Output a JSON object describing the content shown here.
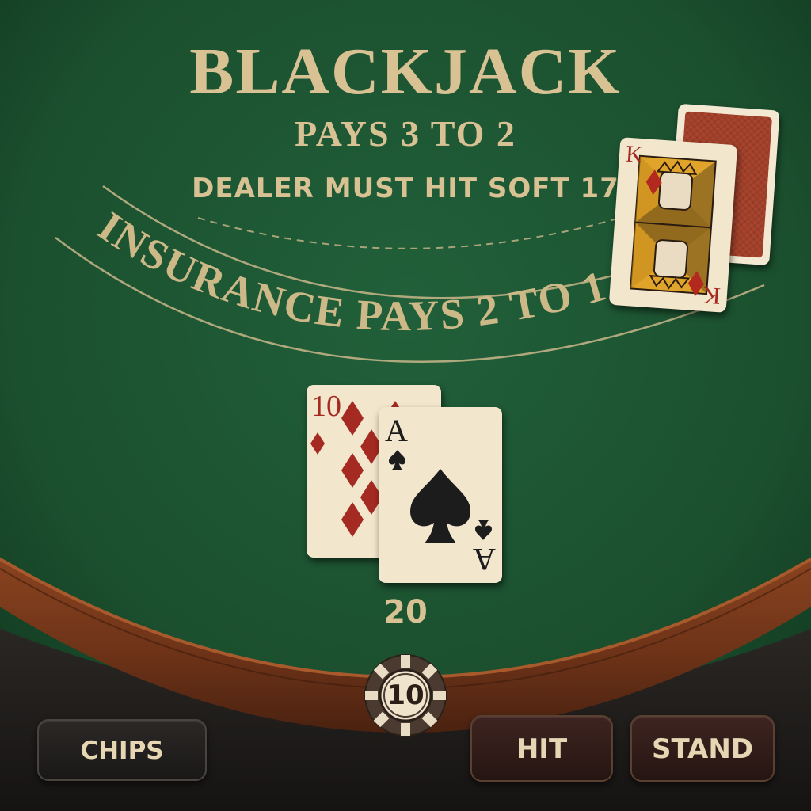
{
  "table": {
    "title": "BLACKJACK",
    "payout": "PAYS  3 TO 2",
    "dealer_rule": "DEALER MUST HIT SOFT 17",
    "insurance": "INSURANCE PAYS 2 TO 1",
    "felt_color": "#1e5330",
    "rail_color": "#7a3a1c",
    "text_color": "#d8c294"
  },
  "dealer": {
    "cards": [
      {
        "rank": "K",
        "suit": "diamonds",
        "face_up": true
      },
      {
        "rank": "",
        "suit": "",
        "face_up": false
      }
    ]
  },
  "player": {
    "cards": [
      {
        "rank": "10",
        "suit": "diamonds"
      },
      {
        "rank": "A",
        "suit": "spades"
      }
    ],
    "total": "20"
  },
  "bet": {
    "chip_value": "10"
  },
  "controls": {
    "chips_label": "CHIPS",
    "hit_label": "HIT",
    "stand_label": "STAND"
  }
}
